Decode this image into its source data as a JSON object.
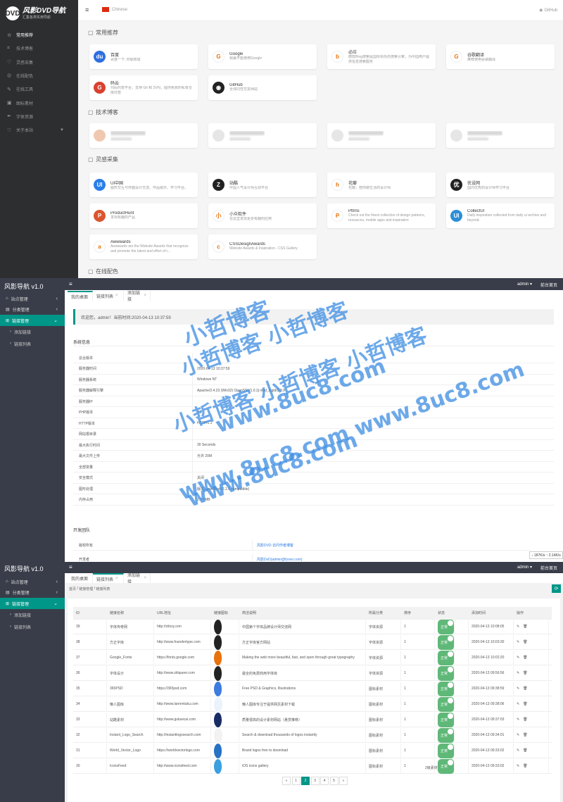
{
  "p1": {
    "brand_title": "风影DVD导航",
    "brand_sub": "汇集各类实用导航",
    "lang": "Chinese",
    "github": "GitHub",
    "nav": [
      {
        "label": "常用推荐",
        "icon": "star-icon"
      },
      {
        "label": "技术博客",
        "icon": "grid-icon"
      },
      {
        "label": "灵感采集",
        "icon": "heart-icon"
      },
      {
        "label": "在线配色",
        "icon": "palette-icon"
      },
      {
        "label": "在线工具",
        "icon": "tool-icon"
      },
      {
        "label": "图标素材",
        "icon": "image-icon"
      },
      {
        "label": "字体资源",
        "icon": "pen-icon"
      },
      {
        "label": "关于本站",
        "icon": "heart-icon"
      }
    ],
    "sections": [
      "常用推荐",
      "技术博客",
      "灵感采集",
      "在线配色"
    ],
    "cards1": [
      {
        "name": "百度",
        "desc": "百度一下, 你就知道",
        "color": "#2f6fe0",
        "g": "du"
      },
      {
        "name": "Google",
        "desc": "我最不能使用Google",
        "color": "#ffffff",
        "g": "G"
      },
      {
        "name": "必应",
        "desc": "微软Bing搜索是国际领先的搜索引擎，为中国用户提供信息搜索服务",
        "color": "#ffffff",
        "g": "b"
      },
      {
        "name": "谷歌翻译",
        "desc": "推荐使用谷歌翻译",
        "color": "#ffffff",
        "g": "G"
      },
      {
        "name": "码云",
        "desc": "代码托管平台，支持 Git 和 SVN，提供免费的私有仓库托管",
        "color": "#d9412f",
        "g": "G"
      },
      {
        "name": "GitHub",
        "desc": "全球同性交友网站",
        "color": "#222222",
        "g": "◉"
      }
    ],
    "cards3": [
      {
        "name": "UI中国",
        "desc": "图形交互与界面设计交流、作品展示、学习平台。",
        "color": "#2b7de9",
        "g": "UI"
      },
      {
        "name": "站酷",
        "desc": "中国人气设计师互动平台",
        "color": "#222222",
        "g": "Z"
      },
      {
        "name": "花瓣",
        "desc": "花瓣，陪你做生活的设计师",
        "color": "#ffffff",
        "g": "h"
      },
      {
        "name": "优设网",
        "desc": "国内优秀的设计师学习平台",
        "color": "#222222",
        "g": "优"
      },
      {
        "name": "ProductHunt",
        "desc": "发现有趣的产品",
        "color": "#da552f",
        "g": "P"
      },
      {
        "name": "小众软件",
        "desc": "在这里发现更多有趣的应用",
        "color": "#ffffff",
        "g": "小"
      },
      {
        "name": "Pttrns",
        "desc": "Check out the finest collection of design patterns, resources, mobile apps and inspiration",
        "color": "#ffffff",
        "g": "P"
      },
      {
        "name": "CollectUI",
        "desc": "Daily inspiration collected from daily ui archive and beyond.",
        "color": "#2b8fd8",
        "g": "UI"
      },
      {
        "name": "Awwwards",
        "desc": "Awwwards are the Website Awards that recognize and promote the talent and effort of t…",
        "color": "#ffffff",
        "g": "a"
      },
      {
        "name": "CSSDesignAwards",
        "desc": "Website Awards & Inspiration - CSS Gallery",
        "color": "#ffffff",
        "g": "c"
      }
    ]
  },
  "p2": {
    "title": "风影导航 v1.0",
    "user": "admin ▾",
    "home": "前台首页",
    "nav": [
      {
        "label": "站点管理"
      },
      {
        "label": "分类管理"
      },
      {
        "label": "链接管理"
      }
    ],
    "subnav": [
      {
        "label": "添加链接"
      },
      {
        "label": "链接列表"
      }
    ],
    "tabs": [
      {
        "label": "我的桌面"
      },
      {
        "label": "链接列表"
      },
      {
        "label": "添加链接"
      }
    ],
    "welcome": "欢迎您，admin！当前时间:2020-04-13 10:37:59",
    "sysinfo": "系统信息",
    "dev": "开发团队",
    "rows": [
      {
        "k": "总台版本",
        "v": ""
      },
      {
        "k": "服务器时间",
        "v": "2020-04-13 10:37:59"
      },
      {
        "k": "服务器系统",
        "v": "Windows NT"
      },
      {
        "k": "服务器解释引擎",
        "v": "Apache/2.4.23 (Win32) OpenSSL/1.0.2j mod_fcgid/2.3.9"
      },
      {
        "k": "服务器IP",
        "v": ""
      },
      {
        "k": "PHP版本",
        "v": "7.1"
      },
      {
        "k": "HTTP版本",
        "v": "HTTP/1.1"
      },
      {
        "k": "网站根目录",
        "v": ""
      },
      {
        "k": "最大执行时间",
        "v": "30 Seconds"
      },
      {
        "k": "最大文件上传",
        "v": "允许 20M"
      },
      {
        "k": "全部变量",
        "v": ""
      },
      {
        "k": "安全模式",
        "v": "关闭"
      },
      {
        "k": "图形处理",
        "v": "版本：bundled (2.1.0 compatible)"
      },
      {
        "k": "内存占用",
        "v": "2.77 MB"
      }
    ],
    "devrows": [
      {
        "k": "版权所有",
        "v": "风影DVD 访问作者博客"
      },
      {
        "k": "开发者",
        "v": "风影DvD(admin@fyovo.com)"
      }
    ],
    "watermark": [
      "小哲博客",
      "小哲博客 小哲博客",
      "小哲博客 小哲博客 小哲博客",
      "www.8uc8.com",
      "www.8uc8.com www.8uc8.com",
      "www.8uc8.com"
    ],
    "speed": "↓ 187K/s  ↑ 2.14K/s"
  },
  "p3": {
    "title": "风影导航 v1.0",
    "user": "admin ▾",
    "home": "前台首页",
    "crumbs": [
      "首页",
      "/",
      "链接管理",
      "/",
      "链接列表"
    ],
    "refresh": "⟳",
    "headers": [
      "ID",
      "链接名称",
      "URL地址",
      "链接图标",
      "简洁说明",
      "所属分类",
      "排序",
      "状态",
      "添加时间",
      "操作"
    ],
    "rows": [
      [
        "39",
        "字体传奇网",
        "http://ziticq.com",
        "中国第个字体品牌设计师交流网",
        "字体资源",
        "1",
        "正常",
        "2020-04-13 10:08:05",
        "#222"
      ],
      [
        "38",
        "方正字库",
        "http://www.foundertype.com",
        "方正字库官方网站",
        "字体资源",
        "1",
        "正常",
        "2020-04-13 10:03:30",
        "#222"
      ],
      [
        "37",
        "Google_Fonts",
        "https://fonts.google.com",
        "Making the web more beautiful, fast, and open through great typography",
        "字体资源",
        "1",
        "正常",
        "2020-04-13 10:02:20",
        "#e8710a"
      ],
      [
        "36",
        "字体设计",
        "http://www.zitiqueer.com",
        "最全的免费商用字体库",
        "字体资源",
        "1",
        "正常",
        "2020-04-13 09:56:56",
        "#222"
      ],
      [
        "35",
        "365PSD",
        "https://365psd.com",
        "Free PSD & Graphics, Illustrations",
        "图标素材",
        "1",
        "正常",
        "2020-04-13 09:38:59",
        "#3d7be0"
      ],
      [
        "34",
        "懒人图库",
        "http://www.lanrentuku.com",
        "懒人图库专注于提供网页素材下载",
        "图标素材",
        "1",
        "正常",
        "2020-04-13 09:38:06",
        "#eaf2fb"
      ],
      [
        "33",
        "站酷素材",
        "http://www.gutuwcai.com",
        "质量很高的设计素材网站（悬赏推荐）",
        "图标素材",
        "1",
        "正常",
        "2020-04-13 09:37:03",
        "#1a2c66"
      ],
      [
        "32",
        "Instant_Logo_Search",
        "http://instantlogosearch.com",
        "Search & download thousands of logos instantly",
        "图标素材",
        "1",
        "正常",
        "2020-04-13 09:34:01",
        "#f2f2f2"
      ],
      [
        "31",
        "World_Vector_Logo",
        "https://worldvectorlogo.com",
        "Brand logos free to download",
        "图标素材",
        "1",
        "正常",
        "2020-04-13 09:33:02",
        "#2671c6"
      ],
      [
        "30",
        "IconsFeed",
        "http://www.iconsfeed.com",
        "iOS icons gallery",
        "图标素材",
        "1",
        "正常",
        "2020-04-13 09:33:02",
        "#3aa0e0"
      ]
    ],
    "pages": [
      "«",
      "1",
      "2",
      "3",
      "4",
      "5",
      "»"
    ],
    "activepage": "2",
    "extra": "2级素材"
  }
}
